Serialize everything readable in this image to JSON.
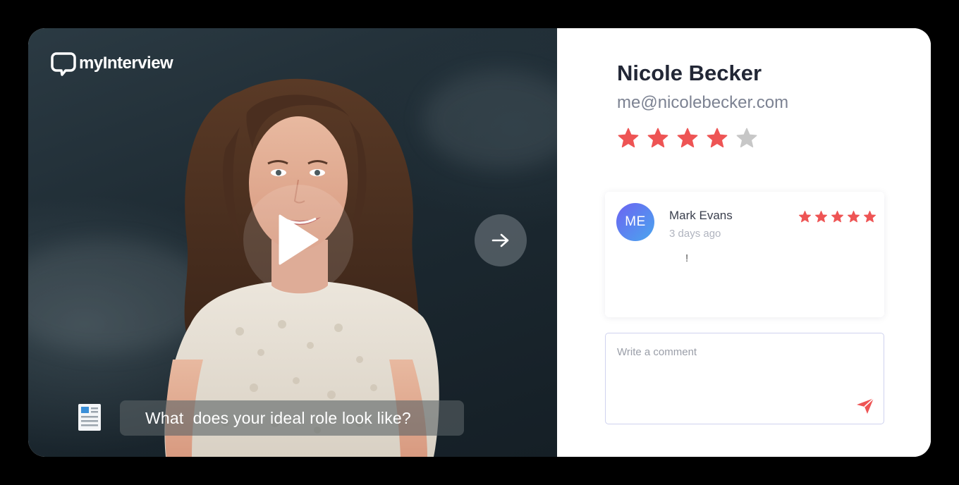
{
  "brand": {
    "name": "myInterview"
  },
  "video": {
    "question": "What  does your ideal role look like?",
    "play_icon": "play-icon",
    "next_icon": "arrow-right-icon",
    "doc_icon": "document-icon"
  },
  "candidate": {
    "name": "Nicole Becker",
    "email": "me@nicolebecker.com",
    "rating": 4,
    "rating_max": 5
  },
  "review": {
    "avatar_initials": "ME",
    "reviewer": "Mark Evans",
    "time": "3 days ago",
    "body": "!",
    "rating": 5,
    "rating_max": 5
  },
  "comment": {
    "placeholder": "Write a comment",
    "send_icon": "send-icon"
  },
  "colors": {
    "star_active": "#ee5454",
    "star_inactive": "#c7c7c7",
    "avatar_from": "#6c63f2",
    "avatar_to": "#4aa6ee"
  }
}
